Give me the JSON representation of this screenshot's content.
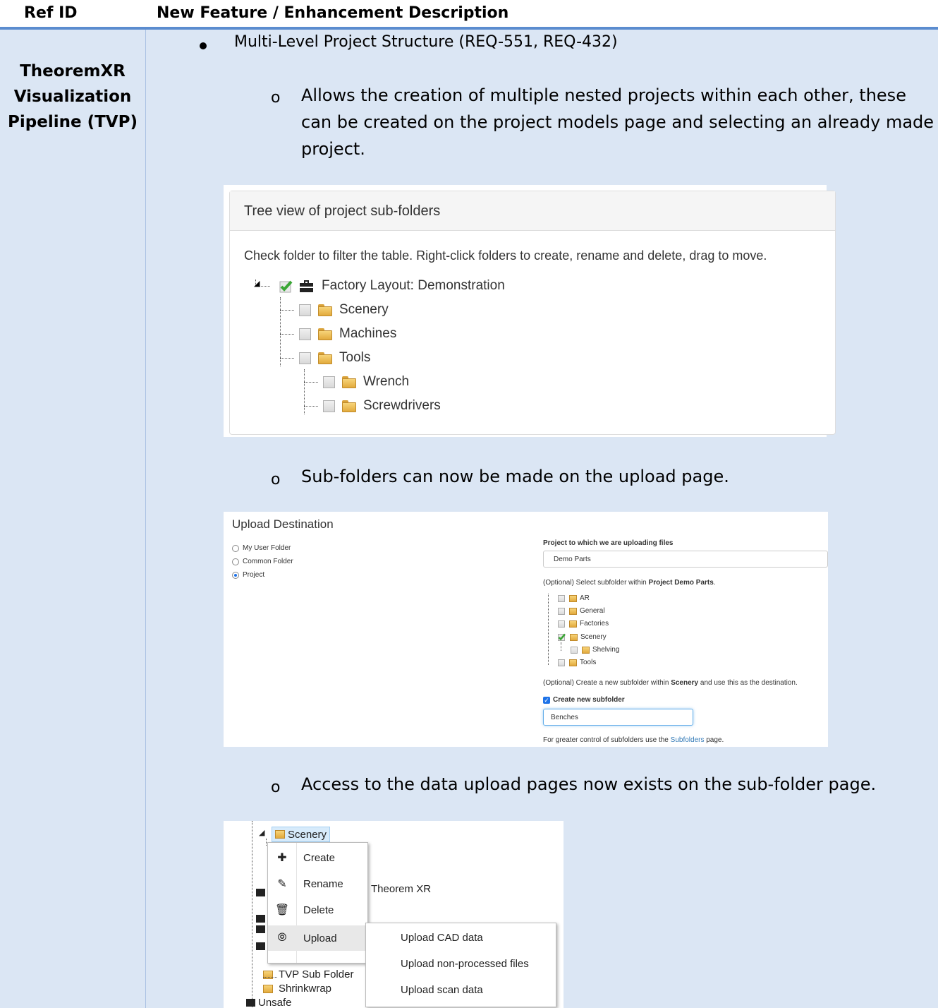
{
  "table": {
    "header": {
      "ref_id": "Ref ID",
      "description": "New Feature / Enhancement Description"
    },
    "row": {
      "ref_title_line1": "TheoremXR",
      "ref_title_line2": "Visualization",
      "ref_title_line3": "Pipeline (TVP)",
      "bullet": "Multi-Level Project Structure (REQ-551, REQ-432)",
      "sub1_line1": "Allows the creation of multiple nested projects within each other, these",
      "sub1_line2": "can be created on the project models page and selecting an already made",
      "sub1_line3": "project.",
      "sub2": "Sub-folders can now be made on the upload page.",
      "sub3": "Access to the data upload pages now exists on the sub-folder page.",
      "sub_marker": "o"
    }
  },
  "tree_view": {
    "title": "Tree view of project sub-folders",
    "instructions": "Check folder to filter the table. Right-click folders to create, rename and delete, drag to move.",
    "root": "Factory Layout: Demonstration",
    "items": [
      "Scenery",
      "Machines",
      "Tools"
    ],
    "tools_children": [
      "Wrench",
      "Screwdrivers"
    ]
  },
  "upload": {
    "title": "Upload Destination",
    "radios": [
      "My User Folder",
      "Common Folder",
      "Project"
    ],
    "project_label": "Project to which we are uploading files",
    "project_value": "Demo Parts",
    "subfolder_prefix": "(Optional) Select subfolder within ",
    "subfolder_project": "Project Demo Parts",
    "subfolder_suffix": ".",
    "folders": [
      "AR",
      "General",
      "Factories",
      "Scenery",
      "Shelving",
      "Tools"
    ],
    "create_prefix": "(Optional) Create a new subfolder within ",
    "create_target": "Scenery",
    "create_suffix": " and use this as the destination.",
    "create_checkbox": "Create new subfolder",
    "new_folder_value": "Benches",
    "footer_prefix": "For greater control of subfolders use the ",
    "footer_link": "Subfolders",
    "footer_suffix": " page."
  },
  "context_menu": {
    "selected_folder": "Scenery",
    "items": [
      "Create",
      "Rename",
      "Delete",
      "Upload"
    ],
    "behind_text": "Theorem XR",
    "tree_items": [
      "TVP Sub Folder",
      "Shrinkwrap",
      "Unsafe"
    ],
    "submenu": [
      "Upload CAD data",
      "Upload non-processed files",
      "Upload scan data"
    ]
  }
}
